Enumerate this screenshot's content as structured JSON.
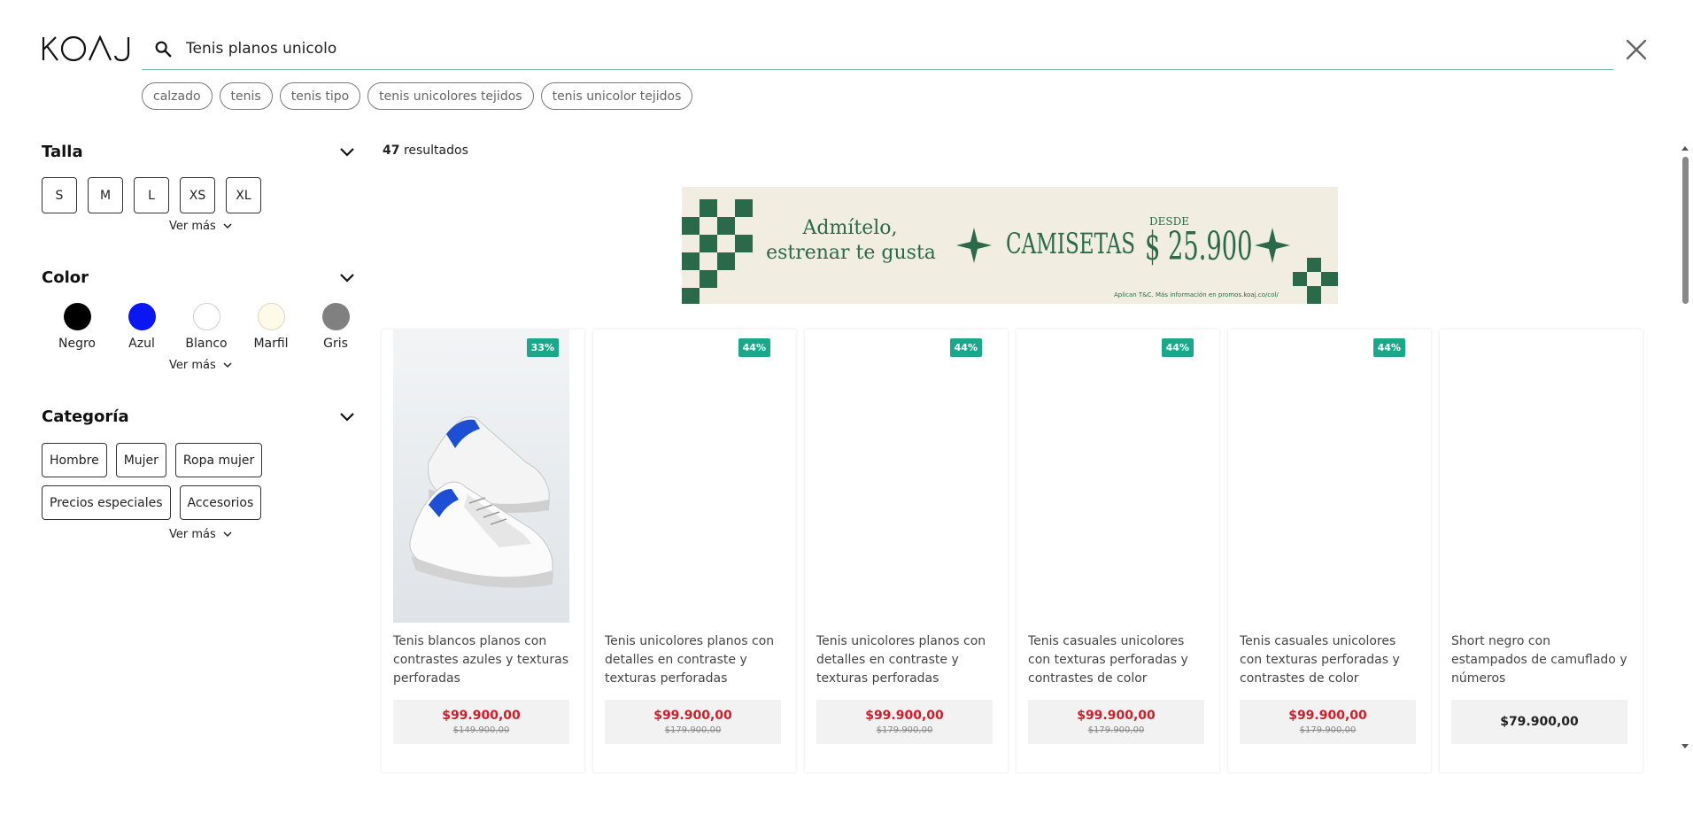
{
  "header": {
    "logo_text": "KOAJ",
    "search_value": "Tenis planos unicolo",
    "suggestions": [
      "calzado",
      "tenis",
      "tenis tipo",
      "tenis unicolores tejidos",
      "tenis unicolor tejidos"
    ]
  },
  "filters": {
    "size": {
      "title": "Talla",
      "options": [
        "S",
        "M",
        "L",
        "XS",
        "XL"
      ],
      "more": "Ver más"
    },
    "color": {
      "title": "Color",
      "options": [
        {
          "label": "Negro",
          "hex": "#000000"
        },
        {
          "label": "Azul",
          "hex": "#0a17f2"
        },
        {
          "label": "Blanco",
          "hex": "#ffffff"
        },
        {
          "label": "Marfil",
          "hex": "#fdfbe8"
        },
        {
          "label": "Gris",
          "hex": "#808080"
        }
      ],
      "more": "Ver más"
    },
    "category": {
      "title": "Categoría",
      "options": [
        "Hombre",
        "Mujer",
        "Ropa mujer",
        "Precios especiales",
        "Accesorios"
      ],
      "more": "Ver más"
    }
  },
  "results": {
    "count": "47",
    "count_label": "resultados"
  },
  "banner": {
    "line1": "Admítelo,",
    "line2": "estrenar te gusta",
    "product": "CAMISETAS",
    "from_label": "DESDE",
    "price": "$ 25.900",
    "disclaimer": "Aplican T&C. Más información en promos.koaj.co/col/",
    "brand_color": "#2a6a4a"
  },
  "products": [
    {
      "title": "Tenis blancos planos con contrastes azules y texturas perforadas",
      "badge": "33%",
      "price": "$99.900,00",
      "old_price": "$149.900,00",
      "has_image": true
    },
    {
      "title": "Tenis unicolores planos con detalles en contraste y texturas perforadas",
      "badge": "44%",
      "price": "$99.900,00",
      "old_price": "$179.900,00",
      "has_image": false
    },
    {
      "title": "Tenis unicolores planos con detalles en contraste y texturas perforadas",
      "badge": "44%",
      "price": "$99.900,00",
      "old_price": "$179.900,00",
      "has_image": false
    },
    {
      "title": "Tenis casuales unicolores con texturas perforadas y contrastes de color",
      "badge": "44%",
      "price": "$99.900,00",
      "old_price": "$179.900,00",
      "has_image": false
    },
    {
      "title": "Tenis casuales unicolores con texturas perforadas y contrastes de color",
      "badge": "44%",
      "price": "$99.900,00",
      "old_price": "$179.900,00",
      "has_image": false
    },
    {
      "title": "Short negro con estampados de camuflado y números",
      "badge": "",
      "price": "$79.900,00",
      "old_price": "",
      "has_image": false
    }
  ],
  "icons": {
    "search": "search-icon",
    "close": "close-icon",
    "chevron": "chevron-down-icon"
  },
  "colors": {
    "accent_line": "#7ebfa0",
    "badge": "#19a98a",
    "sale_price": "#cc1f2a"
  }
}
